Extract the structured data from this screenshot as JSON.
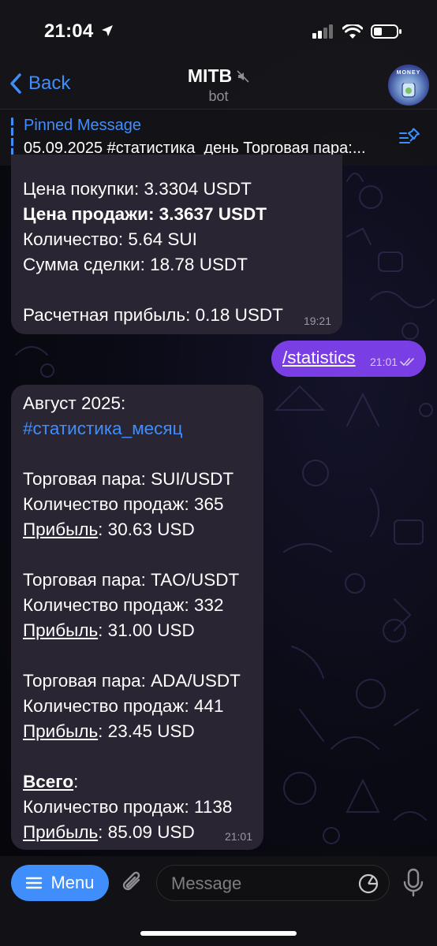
{
  "status": {
    "time": "21:04"
  },
  "header": {
    "back_label": "Back",
    "title": "MITB",
    "subtitle": "bot",
    "avatar_text": "MONEY"
  },
  "pinned": {
    "title": "Pinned Message",
    "text": "05.09.2025 #статистика_день Торговая пара:..."
  },
  "message1": {
    "lines": [
      "Цена покупки: 3.3304 USDT",
      "Цена продажи: 3.3637 USDT",
      "Количество: 5.64 SUI",
      "Сумма сделки: 18.78 USDT",
      "Расчетная прибыль: 0.18 USDT"
    ],
    "time": "19:21"
  },
  "outgoing": {
    "text": "/statistics",
    "time": "21:01"
  },
  "message2": {
    "header": "Август 2025:",
    "hashtag": "#статистика_месяц",
    "pairs": [
      {
        "pair": "Торговая пара: SUI/USDT",
        "sales": "Количество продаж: 365",
        "profit_label": "Прибыль",
        "profit_value": ": 30.63 USD"
      },
      {
        "pair": "Торговая пара: TAO/USDT",
        "sales": "Количество продаж: 332",
        "profit_label": "Прибыль",
        "profit_value": ": 31.00 USD"
      },
      {
        "pair": "Торговая пара: ADA/USDT",
        "sales": "Количество продаж: 441",
        "profit_label": "Прибыль",
        "profit_value": ": 23.45 USD"
      }
    ],
    "total_label": "Всего",
    "total_colon": ":",
    "total_sales": "Количество продаж: 1138",
    "total_profit_label": "Прибыль",
    "total_profit_value": ": 85.09 USD",
    "time": "21:01"
  },
  "input": {
    "menu_label": "Menu",
    "placeholder": "Message"
  },
  "colors": {
    "accent": "#3f8efc",
    "outgoing": "#7a3fe4",
    "bubble_in": "#2b2634"
  }
}
